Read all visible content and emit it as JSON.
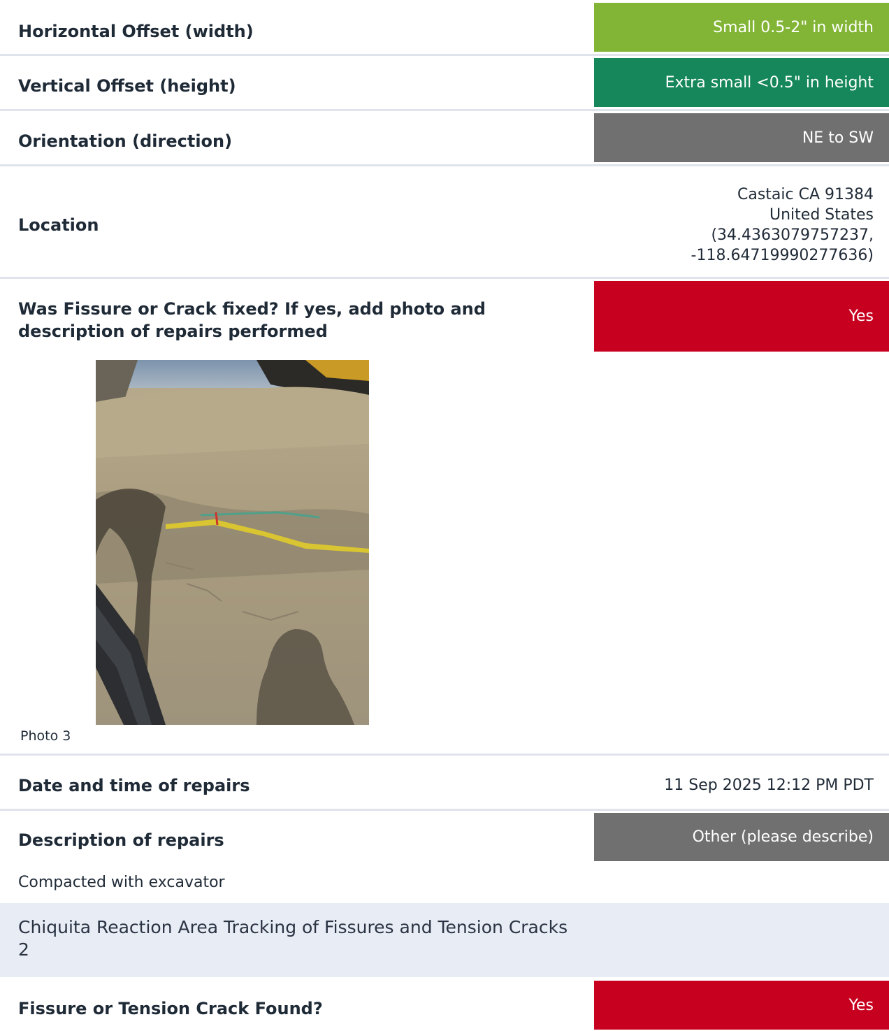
{
  "rows": {
    "horizontal": {
      "label": "Horizontal Offset (width)",
      "value": "Small 0.5-2\" in width",
      "color": "#82b535"
    },
    "vertical": {
      "label": "Vertical Offset (height)",
      "value": "Extra small <0.5\" in height",
      "color": "#16875a"
    },
    "orientation": {
      "label": "Orientation (direction)",
      "value": "NE to SW",
      "color": "#707070"
    },
    "location": {
      "label": "Location",
      "lines": [
        "Castaic CA 91384",
        "United States",
        "(34.4363079757237,",
        "-118.64719990277636)"
      ]
    },
    "fixed": {
      "label": "Was Fissure or Crack fixed? If yes, add photo and description of repairs performed",
      "value": "Yes",
      "color": "#c8001f"
    },
    "photo_caption": "Photo 3",
    "repair_date": {
      "label": "Date and time of repairs",
      "value": "11 Sep 2025 12:12 PM PDT"
    },
    "repair_desc": {
      "label": "Description of repairs",
      "value": "Other (please describe)",
      "color": "#707070"
    },
    "repair_note": "Compacted with excavator"
  },
  "section": {
    "title": "Chiquita Reaction Area Tracking of Fissures and Tension Cracks 2"
  },
  "found": {
    "label": "Fissure or Tension Crack Found?",
    "value": "Yes",
    "color": "#c8001f"
  }
}
